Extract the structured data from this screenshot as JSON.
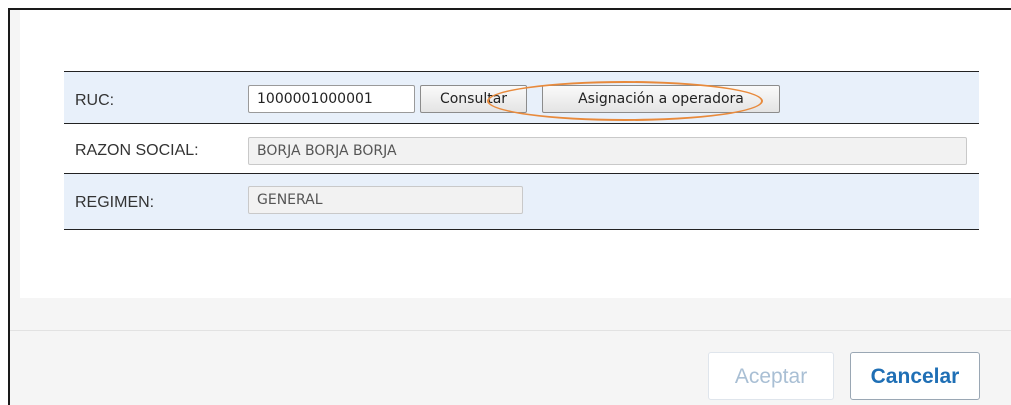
{
  "form": {
    "ruc": {
      "label": "RUC:",
      "value": "1000001000001",
      "consultar_label": "Consultar",
      "asignacion_label": "Asignación a operadora"
    },
    "razon_social": {
      "label": "RAZON SOCIAL:",
      "value": "BORJA BORJA BORJA"
    },
    "regimen": {
      "label": "REGIMEN:",
      "value": "GENERAL"
    }
  },
  "footer": {
    "aceptar_label": "Aceptar",
    "cancelar_label": "Cancelar"
  },
  "colors": {
    "row_highlight": "#e8f0fa",
    "annotation_ellipse": "#e88a3c",
    "cancelar_text": "#1f6fb5",
    "aceptar_disabled_text": "#a9bfd4"
  }
}
